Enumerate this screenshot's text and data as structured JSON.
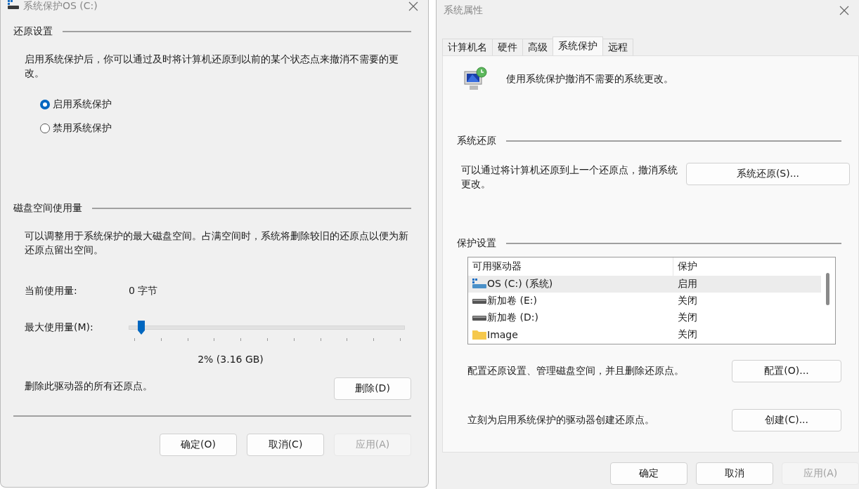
{
  "left_dialog": {
    "title": "系统保护OS (C:)",
    "restore_settings": {
      "heading": "还原设置",
      "description": "启用系统保护后，你可以通过及时将计算机还原到以前的某个状态点来撤消不需要的更改。",
      "options": [
        {
          "label": "启用系统保护",
          "selected": true
        },
        {
          "label": "禁用系统保护",
          "selected": false
        }
      ]
    },
    "disk_usage": {
      "heading": "磁盘空间使用量",
      "description": "可以调整用于系统保护的最大磁盘空间。占满空间时，系统将删除较旧的还原点以便为新还原点留出空间。",
      "current_label": "当前使用量:",
      "current_value": "0 字节",
      "max_label": "最大使用量(M):",
      "max_slider": {
        "level": 0.02
      },
      "max_reading": "2% (3.16 GB)"
    },
    "delete_row": {
      "text": "删除此驱动器的所有还原点。",
      "button": "删除(D)"
    },
    "buttons": [
      {
        "label": "确定(O)",
        "disabled": false
      },
      {
        "label": "取消(C)",
        "disabled": false
      },
      {
        "label": "应用(A)",
        "disabled": true
      }
    ]
  },
  "right_dialog": {
    "title": "系统属性",
    "tabs": [
      {
        "label": "计算机名",
        "selected": false
      },
      {
        "label": "硬件",
        "selected": false
      },
      {
        "label": "高级",
        "selected": false
      },
      {
        "label": "系统保护",
        "selected": true
      },
      {
        "label": "远程",
        "selected": false
      }
    ],
    "intro": "使用系统保护撤消不需要的系统更改。",
    "system_restore": {
      "heading": "系统还原",
      "description": "可以通过将计算机还原到上一个还原点，撤消系统更改。",
      "button": "系统还原(S)..."
    },
    "protection_settings": {
      "heading": "保护设置",
      "columns": [
        "可用驱动器",
        "保护"
      ],
      "rows": [
        {
          "kind": "system-drive",
          "drive": "OS (C:) (系统)",
          "protection": "启用",
          "selected": true
        },
        {
          "kind": "drive",
          "drive": "新加卷 (E:)",
          "protection": "关闭",
          "selected": false
        },
        {
          "kind": "drive",
          "drive": "新加卷 (D:)",
          "protection": "关闭",
          "selected": false
        },
        {
          "kind": "folder",
          "drive": "Image",
          "protection": "关闭",
          "selected": false
        }
      ]
    },
    "configure_row": {
      "text": "配置还原设置、管理磁盘空间，并且删除还原点。",
      "button": "配置(O)..."
    },
    "create_row": {
      "text": "立刻为启用系统保护的驱动器创建还原点。",
      "button": "创建(C)..."
    },
    "buttons": [
      {
        "label": "确定",
        "disabled": false
      },
      {
        "label": "取消",
        "disabled": false
      },
      {
        "label": "应用(A)",
        "disabled": true
      }
    ]
  }
}
